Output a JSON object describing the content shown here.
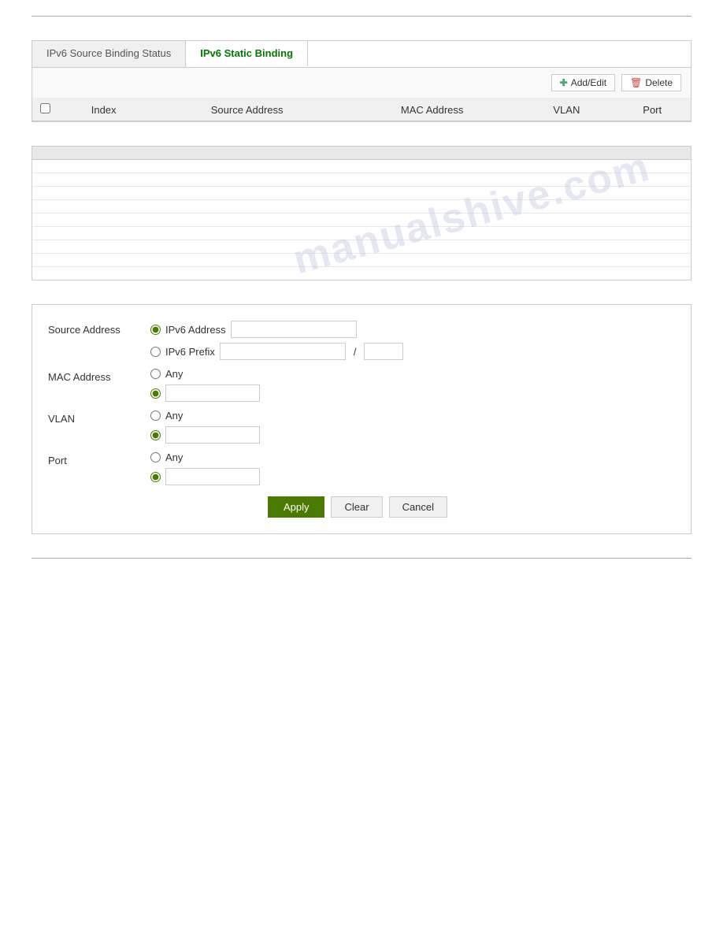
{
  "page": {
    "top_divider": true,
    "bottom_divider": true
  },
  "tabs": {
    "items": [
      {
        "id": "ipv6-source-binding-status",
        "label": "IPv6 Source Binding Status",
        "active": false
      },
      {
        "id": "ipv6-static-binding",
        "label": "IPv6 Static Binding",
        "active": true
      }
    ]
  },
  "toolbar": {
    "add_edit_label": "Add/Edit",
    "delete_label": "Delete"
  },
  "binding_table": {
    "columns": [
      "",
      "Index",
      "Source Address",
      "MAC Address",
      "VLAN",
      "Port"
    ],
    "rows": []
  },
  "generic_table": {
    "rows": [
      {
        "label": "",
        "value": ""
      },
      {
        "label": "",
        "value": ""
      },
      {
        "label": "",
        "value": ""
      },
      {
        "label": "",
        "value": ""
      },
      {
        "label": "",
        "value": ""
      },
      {
        "label": "",
        "value": ""
      },
      {
        "label": "",
        "value": ""
      },
      {
        "label": "",
        "value": ""
      },
      {
        "label": "",
        "value": ""
      }
    ]
  },
  "watermark": "manualshive.com",
  "form": {
    "source_address_label": "Source Address",
    "ipv6_address_radio_label": "IPv6 Address",
    "ipv6_prefix_radio_label": "IPv6 Prefix",
    "slash_sep": "/",
    "mac_address_label": "MAC Address",
    "any_label": "Any",
    "vlan_label": "VLAN",
    "port_label": "Port",
    "buttons": {
      "apply": "Apply",
      "clear": "Clear",
      "cancel": "Cancel"
    }
  }
}
